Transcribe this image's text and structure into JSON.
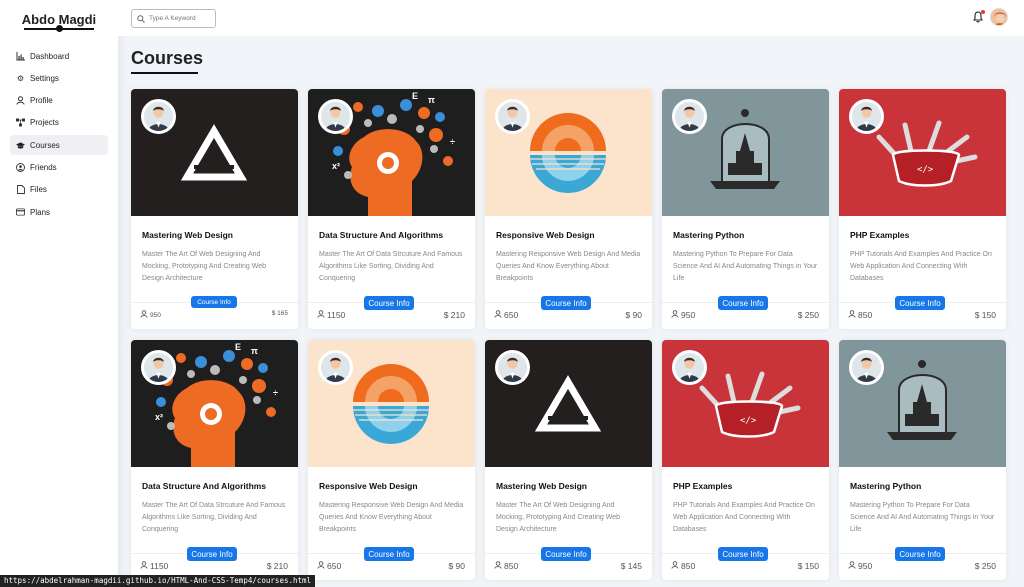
{
  "brand": "Abdo Magdi",
  "nav": [
    {
      "label": "Dashboard",
      "icon": "chart-icon"
    },
    {
      "label": "Settings",
      "icon": "gear-icon"
    },
    {
      "label": "Profile",
      "icon": "user-icon"
    },
    {
      "label": "Projects",
      "icon": "diagram-icon"
    },
    {
      "label": "Courses",
      "icon": "graduation-cap-icon",
      "active": true
    },
    {
      "label": "Friends",
      "icon": "circle-user-icon"
    },
    {
      "label": "Files",
      "icon": "file-icon"
    },
    {
      "label": "Plans",
      "icon": "credit-card-icon"
    }
  ],
  "search": {
    "placeholder": "Type A Keyword",
    "value": ""
  },
  "page_title": "Courses",
  "info_label": "Course Info",
  "courses": [
    {
      "title": "Mastering Web Design",
      "desc": "Master The Art Of Web Designing And Mocking, Prototyping And Creating Web Design Architecture",
      "students": "950",
      "price": "$ 165",
      "theme": "web"
    },
    {
      "title": "Data Structure And Algorithms",
      "desc": "Master The Art Of Data Strcuture And Famous Algorithms Like Sorting, Dividing And Conquering",
      "students": "1150",
      "price": "$ 210",
      "theme": "data"
    },
    {
      "title": "Responsive Web Design",
      "desc": "Mastering Responsive Web Design And Media Queries And Know Everything About Breakpoints",
      "students": "650",
      "price": "$ 90",
      "theme": "responsive"
    },
    {
      "title": "Mastering Python",
      "desc": "Mastering Python To Prepare For Data Science And AI And Automating Things in Your Life",
      "students": "950",
      "price": "$ 250",
      "theme": "python"
    },
    {
      "title": "PHP Examples",
      "desc": "PHP Tutorials And Examples And Practice On Web Application And Connecting With Databases",
      "students": "850",
      "price": "$ 150",
      "theme": "php"
    },
    {
      "title": "Data Structure And Algorithms",
      "desc": "Master The Art Of Data Strcuture And Famous Algorithms Like Sorting, Dividing And Conquering",
      "students": "1150",
      "price": "$ 210",
      "theme": "data"
    },
    {
      "title": "Responsive Web Design",
      "desc": "Mastering Responsive Web Design And Media Queries And Know Everything About Breakpoints",
      "students": "650",
      "price": "$ 90",
      "theme": "responsive"
    },
    {
      "title": "Mastering Web Design",
      "desc": "Master The Art Of Web Designing And Mocking, Prototyping And Creating Web Design Architecture",
      "students": "850",
      "price": "$ 145",
      "theme": "web"
    },
    {
      "title": "PHP Examples",
      "desc": "PHP Tutorials And Examples And Practice On Web Application And Connecting With Databases",
      "students": "850",
      "price": "$ 150",
      "theme": "php"
    },
    {
      "title": "Mastering Python",
      "desc": "Mastering Python To Prepare For Data Science And AI And Automating Things in Your Life",
      "students": "950",
      "price": "$ 250",
      "theme": "python"
    }
  ],
  "status_url": "https://abdelrahman-magdii.github.io/HTML-And-CSS-Temp4/courses.html"
}
